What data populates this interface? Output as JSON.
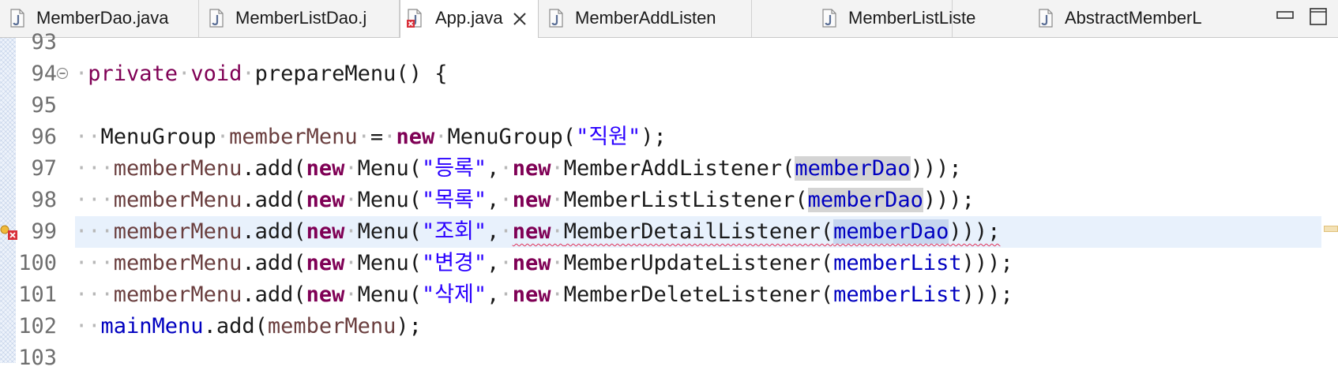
{
  "tabs": [
    {
      "label": "MemberDao.java",
      "icon": "java-file-icon",
      "active": false
    },
    {
      "label": "MemberListDao.j",
      "icon": "java-file-icon",
      "active": false
    },
    {
      "label": "App.java",
      "icon": "java-file-error-icon",
      "active": true
    },
    {
      "label": "MemberAddListen",
      "icon": "java-file-icon",
      "active": false
    },
    {
      "label": "MemberListListe",
      "icon": "java-file-icon",
      "active": false
    },
    {
      "label": "AbstractMemberL",
      "icon": "java-file-icon",
      "active": false
    }
  ],
  "window_controls": [
    "minimize-icon",
    "maximize-icon"
  ],
  "editor": {
    "current_line": "99",
    "error_line": "99",
    "line_numbers": [
      "93",
      "94",
      "95",
      "96",
      "97",
      "98",
      "99",
      "100",
      "101",
      "102",
      "103"
    ],
    "code": {
      "l94": {
        "kw1": "private",
        "kw2": "void",
        "rest": "prepareMenu() {"
      },
      "l96": {
        "type": "MenuGroup",
        "var": "memberMenu",
        "eq": "=",
        "kw": "new",
        "ctor": "MenuGroup(",
        "str": "\"직원\"",
        "end": ");"
      },
      "l97": {
        "var": "memberMenu",
        "a": ".add(",
        "kw1": "new",
        "b": "Menu(",
        "str": "\"등록\"",
        "c": ",",
        "kw2": "new",
        "d": "MemberAddListener(",
        "arg": "memberDao",
        "end": ")));"
      },
      "l98": {
        "var": "memberMenu",
        "a": ".add(",
        "kw1": "new",
        "b": "Menu(",
        "str": "\"목록\"",
        "c": ",",
        "kw2": "new",
        "d": "MemberListListener(",
        "arg": "memberDao",
        "end": ")));"
      },
      "l99": {
        "var": "memberMenu",
        "a": ".add(",
        "kw1": "new",
        "b": "Menu(",
        "str": "\"조회\"",
        "c": ",",
        "kw2": "new",
        "d": "MemberDetailListener(",
        "arg": "memberDao",
        "end": ")));"
      },
      "l100": {
        "var": "memberMenu",
        "a": ".add(",
        "kw1": "new",
        "b": "Menu(",
        "str": "\"변경\"",
        "c": ",",
        "kw2": "new",
        "d": "MemberUpdateListener(",
        "arg": "memberList",
        "end": ")));"
      },
      "l101": {
        "var": "memberMenu",
        "a": ".add(",
        "kw1": "new",
        "b": "Menu(",
        "str": "\"삭제\"",
        "c": ",",
        "kw2": "new",
        "d": "MemberDeleteListener(",
        "arg": "memberList",
        "end": ")));"
      },
      "l102": {
        "field": "mainMenu",
        "a": ".add(",
        "var": "memberMenu",
        "end": ");"
      }
    }
  },
  "colors": {
    "keyword": "#7f0055",
    "string": "#2a00ff",
    "field": "#0000c0",
    "local_variable": "#6a3e3e",
    "current_line": "#e8f1fc",
    "occurrence_highlight": "#d4d4d4",
    "error_underline": "#e0325a"
  }
}
